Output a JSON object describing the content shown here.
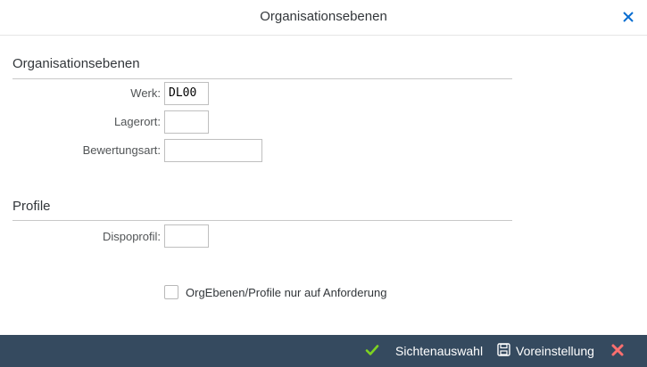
{
  "dialog": {
    "title": "Organisationsebenen",
    "close_icon": "close-icon"
  },
  "org_section": {
    "title": "Organisationsebenen",
    "fields": [
      {
        "label": "Werk:",
        "value": "DL00"
      },
      {
        "label": "Lagerort:",
        "value": ""
      },
      {
        "label": "Bewertungsart:",
        "value": ""
      }
    ]
  },
  "profile_section": {
    "title": "Profile",
    "fields": [
      {
        "label": "Dispoprofil:",
        "value": ""
      }
    ]
  },
  "checkbox": {
    "label": "OrgEbenen/Profile nur auf Anforderung",
    "checked": false
  },
  "footer": {
    "select_view_label": "Sichtenauswahl",
    "select_view_icon": "checkmark-icon",
    "default_label": "Voreinstellung",
    "default_icon": "save-icon",
    "cancel_icon": "cancel-x-icon"
  },
  "colors": {
    "footer_bg": "#354a5f",
    "accent_blue": "#0a6ed1",
    "confirm_green": "#7ed321",
    "cancel_red": "#ff6f6f"
  }
}
